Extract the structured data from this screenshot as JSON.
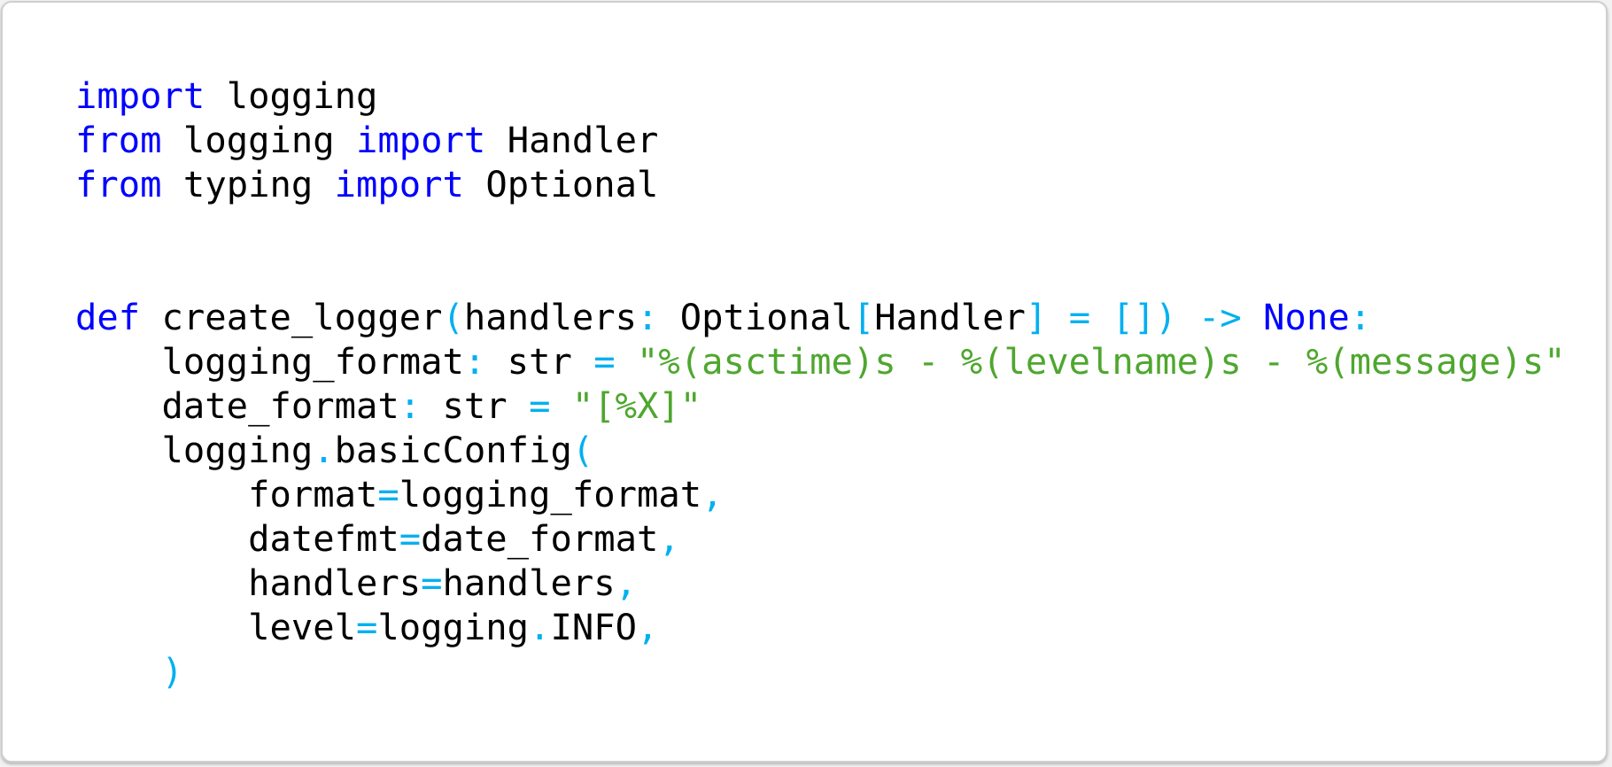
{
  "colors": {
    "keyword": "#0000ff",
    "operator": "#00b0f0",
    "string": "#4ea72e",
    "identifier": "#000000",
    "background": "#ffffff"
  },
  "code": {
    "language": "python",
    "lines": [
      [
        {
          "t": "import",
          "c": "kw"
        },
        {
          "t": " logging",
          "c": "id"
        }
      ],
      [
        {
          "t": "from",
          "c": "kw"
        },
        {
          "t": " logging ",
          "c": "id"
        },
        {
          "t": "import",
          "c": "kw"
        },
        {
          "t": " Handler",
          "c": "id"
        }
      ],
      [
        {
          "t": "from",
          "c": "kw"
        },
        {
          "t": " typing ",
          "c": "id"
        },
        {
          "t": "import",
          "c": "kw"
        },
        {
          "t": " Optional",
          "c": "id"
        }
      ],
      [],
      [],
      [
        {
          "t": "def",
          "c": "kw"
        },
        {
          "t": " create_logger",
          "c": "id"
        },
        {
          "t": "(",
          "c": "op"
        },
        {
          "t": "handlers",
          "c": "id"
        },
        {
          "t": ":",
          "c": "op"
        },
        {
          "t": " Optional",
          "c": "id"
        },
        {
          "t": "[",
          "c": "op"
        },
        {
          "t": "Handler",
          "c": "id"
        },
        {
          "t": "] = [])",
          "c": "op"
        },
        {
          "t": " ",
          "c": "id"
        },
        {
          "t": "->",
          "c": "op"
        },
        {
          "t": " ",
          "c": "id"
        },
        {
          "t": "None",
          "c": "kw"
        },
        {
          "t": ":",
          "c": "op"
        }
      ],
      [
        {
          "t": "    logging_format",
          "c": "id"
        },
        {
          "t": ":",
          "c": "op"
        },
        {
          "t": " str ",
          "c": "id"
        },
        {
          "t": "=",
          "c": "op"
        },
        {
          "t": " ",
          "c": "id"
        },
        {
          "t": "\"%(asctime)s - %(levelname)s - %(message)s\"",
          "c": "str"
        }
      ],
      [
        {
          "t": "    date_format",
          "c": "id"
        },
        {
          "t": ":",
          "c": "op"
        },
        {
          "t": " str ",
          "c": "id"
        },
        {
          "t": "=",
          "c": "op"
        },
        {
          "t": " ",
          "c": "id"
        },
        {
          "t": "\"[%X]\"",
          "c": "str"
        }
      ],
      [
        {
          "t": "    logging",
          "c": "id"
        },
        {
          "t": ".",
          "c": "op"
        },
        {
          "t": "basicConfig",
          "c": "id"
        },
        {
          "t": "(",
          "c": "op"
        }
      ],
      [
        {
          "t": "        format",
          "c": "id"
        },
        {
          "t": "=",
          "c": "op"
        },
        {
          "t": "logging_format",
          "c": "id"
        },
        {
          "t": ",",
          "c": "op"
        }
      ],
      [
        {
          "t": "        datefmt",
          "c": "id"
        },
        {
          "t": "=",
          "c": "op"
        },
        {
          "t": "date_format",
          "c": "id"
        },
        {
          "t": ",",
          "c": "op"
        }
      ],
      [
        {
          "t": "        handlers",
          "c": "id"
        },
        {
          "t": "=",
          "c": "op"
        },
        {
          "t": "handlers",
          "c": "id"
        },
        {
          "t": ",",
          "c": "op"
        }
      ],
      [
        {
          "t": "        level",
          "c": "id"
        },
        {
          "t": "=",
          "c": "op"
        },
        {
          "t": "logging",
          "c": "id"
        },
        {
          "t": ".",
          "c": "op"
        },
        {
          "t": "INFO",
          "c": "id"
        },
        {
          "t": ",",
          "c": "op"
        }
      ],
      [
        {
          "t": "    ",
          "c": "id"
        },
        {
          "t": ")",
          "c": "op"
        }
      ]
    ]
  }
}
